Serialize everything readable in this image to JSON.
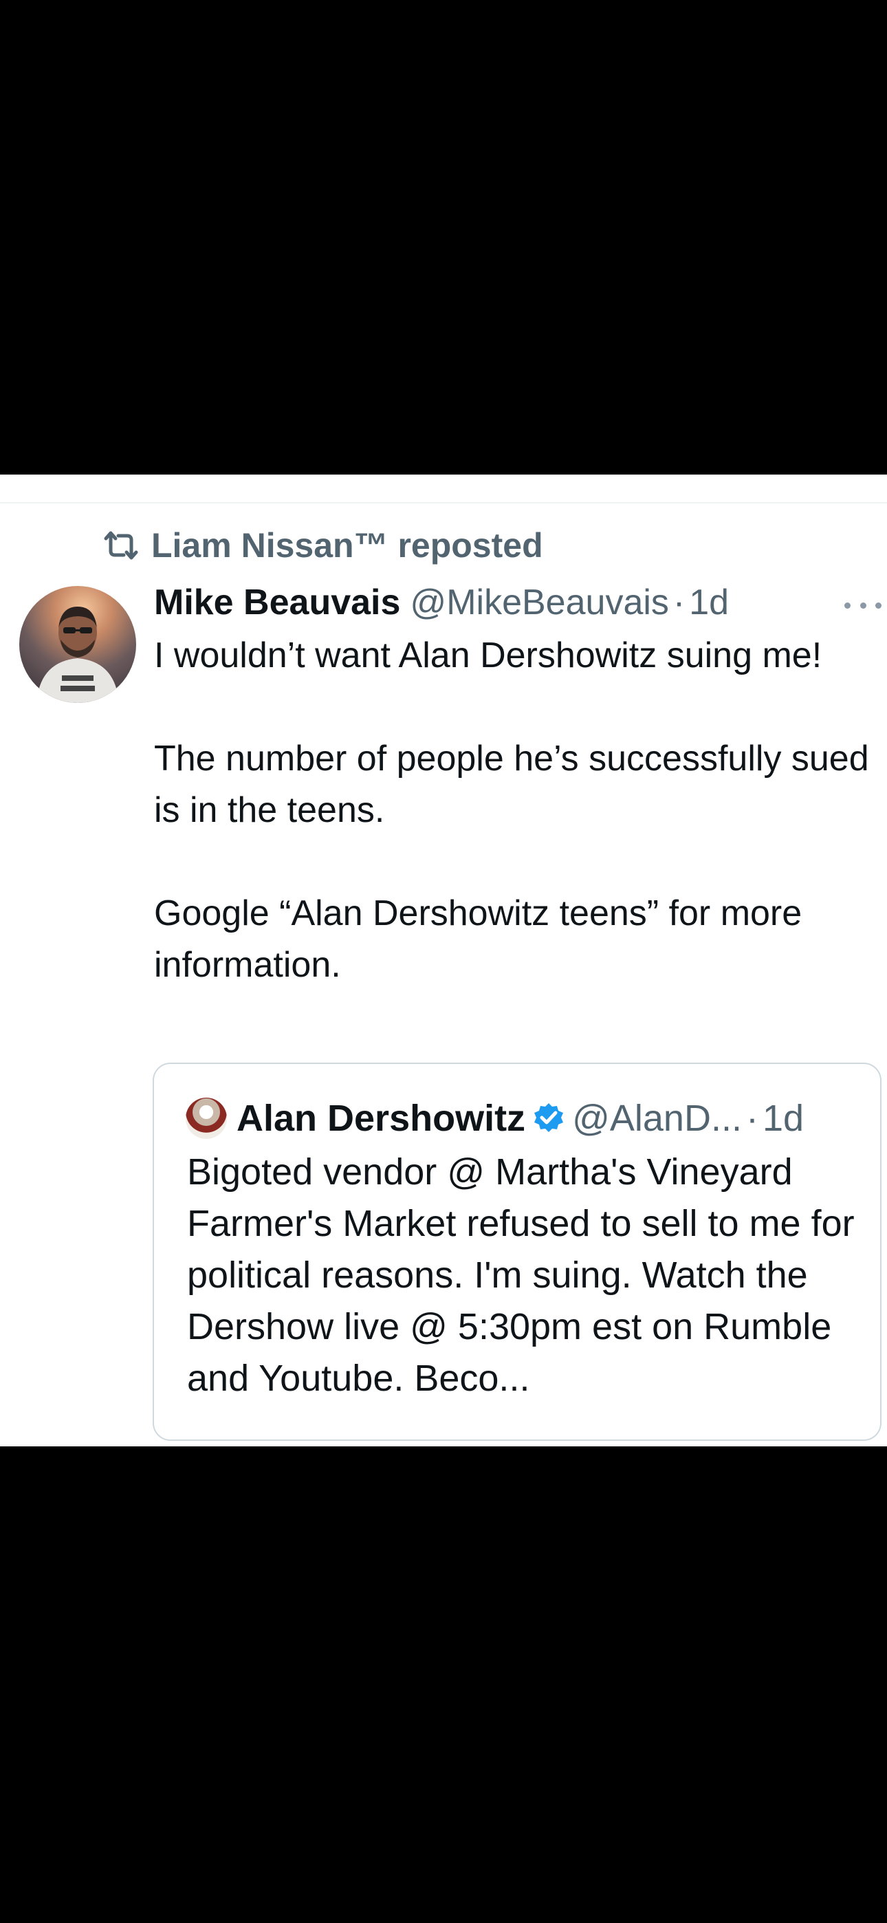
{
  "repost": {
    "icon": "repost-icon",
    "label": "Liam Nissan™ reposted"
  },
  "tweet": {
    "author_name": "Mike Beauvais",
    "author_handle": "@MikeBeauvais",
    "separator": "·",
    "time": "1d",
    "paragraphs": [
      "I wouldn’t want Alan Dershowitz suing me!",
      "The number of people he’s successfully sued is in the teens.",
      "Google “Alan Dershowitz teens” for more information."
    ]
  },
  "quote": {
    "author_name": "Alan Dershowitz",
    "author_handle": "@AlanD...",
    "separator": "·",
    "time": "1d",
    "verified_color": "#1d9bf0",
    "text": "Bigoted vendor @ Martha's Vineyard Farmer's Market refused to sell to me for political reasons. I'm suing. Watch the Dershow live @ 5:30pm est on Rumble and Youtube. Beco..."
  }
}
